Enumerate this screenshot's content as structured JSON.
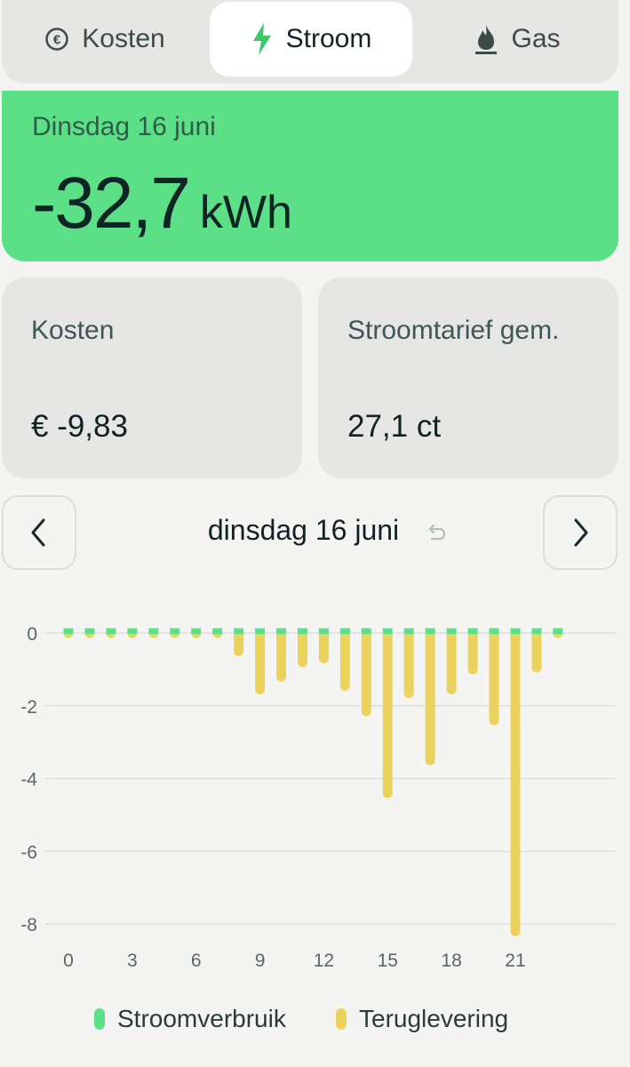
{
  "tabs": [
    {
      "label": "Kosten",
      "icon": "euro-circle-icon",
      "active": false
    },
    {
      "label": "Stroom",
      "icon": "lightning-icon",
      "active": true
    },
    {
      "label": "Gas",
      "icon": "flame-icon",
      "active": false
    }
  ],
  "hero": {
    "date": "Dinsdag 16 juni",
    "value": "-32,7",
    "unit": "kWh",
    "color": "#5ce087"
  },
  "cards": {
    "kosten": {
      "label": "Kosten",
      "value": "€ -9,83"
    },
    "tarief": {
      "label": "Stroomtarief gem.",
      "value": "27,1 ct"
    }
  },
  "nav": {
    "date": "dinsdag 16 juni",
    "prev_icon": "chevron-left-icon",
    "next_icon": "chevron-right-icon",
    "reset_icon": "undo-icon"
  },
  "chart_data": {
    "type": "bar",
    "x": [
      0,
      1,
      2,
      3,
      4,
      5,
      6,
      7,
      8,
      9,
      10,
      11,
      12,
      13,
      14,
      15,
      16,
      17,
      18,
      19,
      20,
      21,
      22,
      23
    ],
    "xticks": [
      0,
      3,
      6,
      9,
      12,
      15,
      18,
      21
    ],
    "yticks": [
      0,
      -2,
      -4,
      -6,
      -8
    ],
    "ylim": [
      -8.3,
      0
    ],
    "grid": true,
    "series": [
      {
        "name": "Stroomverbruik",
        "color": "#5ce087",
        "values": [
          0,
          0,
          0,
          0,
          0,
          0,
          0,
          0,
          0,
          0,
          0,
          0,
          0,
          0,
          0,
          0,
          0,
          0,
          0,
          0,
          0,
          0,
          0,
          0
        ]
      },
      {
        "name": "Teruglevering",
        "color": "#ecd35e",
        "values": [
          0,
          0,
          0,
          0,
          0,
          0,
          0,
          0,
          -0.5,
          -1.55,
          -1.2,
          -0.8,
          -0.7,
          -1.45,
          -2.15,
          -4.4,
          -1.65,
          -3.5,
          -1.55,
          -1.0,
          -2.4,
          -8.2,
          -0.95,
          0
        ]
      }
    ]
  },
  "legend": [
    {
      "label": "Stroomverbruik",
      "color": "#5ce087"
    },
    {
      "label": "Teruglevering",
      "color": "#ecd35e"
    }
  ]
}
